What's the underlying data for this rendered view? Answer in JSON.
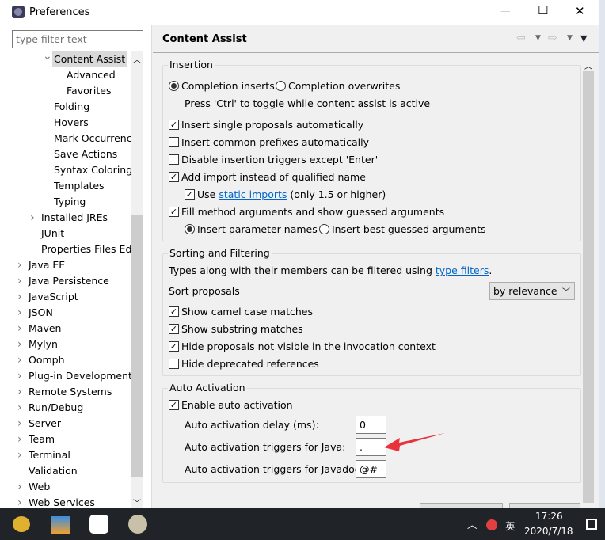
{
  "window": {
    "title": "Preferences",
    "minimize": "—",
    "maximize": "☐",
    "close": "✕"
  },
  "filter": {
    "placeholder": "type filter text"
  },
  "tree": [
    {
      "label": "Content Assist",
      "level": 2,
      "expanded": true,
      "selected": true
    },
    {
      "label": "Advanced",
      "level": 3
    },
    {
      "label": "Favorites",
      "level": 3
    },
    {
      "label": "Folding",
      "level": 2
    },
    {
      "label": "Hovers",
      "level": 2
    },
    {
      "label": "Mark Occurrences",
      "level": 2
    },
    {
      "label": "Save Actions",
      "level": 2
    },
    {
      "label": "Syntax Coloring",
      "level": 2
    },
    {
      "label": "Templates",
      "level": 2
    },
    {
      "label": "Typing",
      "level": 2
    },
    {
      "label": "Installed JREs",
      "level": 1,
      "collapsed": true
    },
    {
      "label": "JUnit",
      "level": 1
    },
    {
      "label": "Properties Files Editor",
      "level": 1
    },
    {
      "label": "Java EE",
      "level": 0,
      "collapsed": true
    },
    {
      "label": "Java Persistence",
      "level": 0,
      "collapsed": true
    },
    {
      "label": "JavaScript",
      "level": 0,
      "collapsed": true
    },
    {
      "label": "JSON",
      "level": 0,
      "collapsed": true
    },
    {
      "label": "Maven",
      "level": 0,
      "collapsed": true
    },
    {
      "label": "Mylyn",
      "level": 0,
      "collapsed": true
    },
    {
      "label": "Oomph",
      "level": 0,
      "collapsed": true
    },
    {
      "label": "Plug-in Development",
      "level": 0,
      "collapsed": true
    },
    {
      "label": "Remote Systems",
      "level": 0,
      "collapsed": true
    },
    {
      "label": "Run/Debug",
      "level": 0,
      "collapsed": true
    },
    {
      "label": "Server",
      "level": 0,
      "collapsed": true
    },
    {
      "label": "Team",
      "level": 0,
      "collapsed": true
    },
    {
      "label": "Terminal",
      "level": 0,
      "collapsed": true
    },
    {
      "label": "Validation",
      "level": 0
    },
    {
      "label": "Web",
      "level": 0,
      "collapsed": true
    },
    {
      "label": "Web Services",
      "level": 0,
      "collapsed": true
    }
  ],
  "page": {
    "title": "Content Assist"
  },
  "insertion": {
    "title": "Insertion",
    "completion_inserts": "Completion inserts",
    "completion_overwrites": "Completion overwrites",
    "toggle_hint": "Press 'Ctrl' to toggle while content assist is active",
    "insert_single": "Insert single proposals automatically",
    "insert_common": "Insert common prefixes automatically",
    "disable_triggers": "Disable insertion triggers except 'Enter'",
    "add_import": "Add import instead of qualified name",
    "use": "Use",
    "static_imports": "static imports",
    "only15": "(only 1.5 or higher)",
    "fill_args": "Fill method arguments and show guessed arguments",
    "insert_param_names": "Insert parameter names",
    "insert_best_guessed": "Insert best guessed arguments"
  },
  "sorting": {
    "title": "Sorting and Filtering",
    "types_text": "Types along with their members can be filtered using",
    "type_filters": "type filters",
    "period": ".",
    "sort_label": "Sort proposals",
    "sort_value": "by relevance",
    "camel": "Show camel case matches",
    "substring": "Show substring matches",
    "hide_not_visible": "Hide proposals not visible in the invocation context",
    "hide_deprecated": "Hide deprecated references"
  },
  "auto": {
    "title": "Auto Activation",
    "enable": "Enable auto activation",
    "delay_label": "Auto activation delay (ms):",
    "delay_value": "0",
    "java_label": "Auto activation triggers for Java:",
    "java_value": ".",
    "javadoc_label": "Auto activation triggers for Javadoc:",
    "javadoc_value": "@#"
  },
  "taskbar": {
    "time": "17:26",
    "date": "2020/7/18",
    "ime": "英"
  },
  "colors": {
    "arrow": "#e8323c",
    "link": "#0066cc"
  }
}
